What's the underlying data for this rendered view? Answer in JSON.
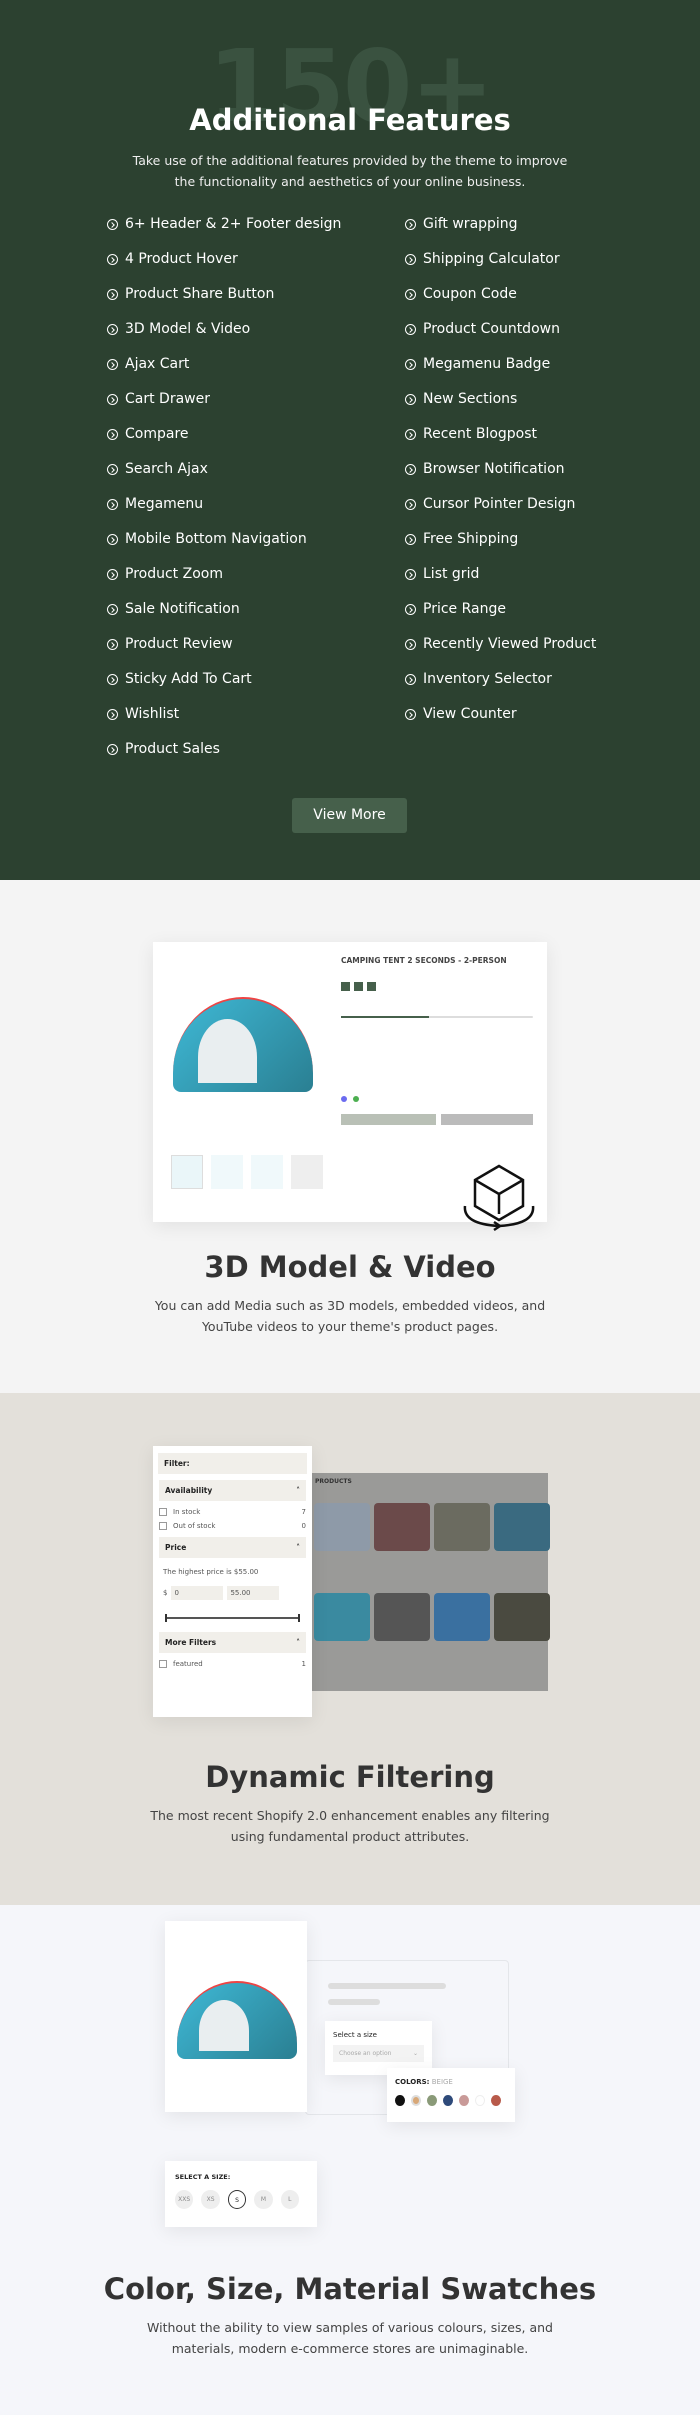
{
  "features": {
    "watermark": "150+",
    "title": "Additional Features",
    "subtitle_lines": [
      "Take use of the additional features provided by the theme to improve",
      "the functionality and aesthetics of your online business."
    ],
    "left": [
      "6+ Header & 2+ Footer design",
      "4 Product Hover",
      "Product Share Button",
      "3D Model & Video",
      "Ajax Cart",
      "Cart Drawer",
      "Compare",
      "Search Ajax",
      "Megamenu",
      "Mobile Bottom Navigation",
      "Product Zoom",
      "Sale Notification",
      "Product Review",
      "Sticky Add To Cart",
      "Wishlist",
      "Product Sales"
    ],
    "right": [
      "Gift wrapping",
      "Shipping Calculator",
      "Coupon Code",
      "Product Countdown",
      "Megamenu Badge",
      "New Sections",
      "Recent Blogpost",
      "Browser Notification",
      "Cursor Pointer Design",
      "Free Shipping",
      "List grid",
      "Price Range",
      "Recently Viewed Product",
      "Inventory Selector",
      "View Counter"
    ],
    "view_more": "View More",
    "icon": "circle-arrow-right-icon",
    "bg_color": "#2c4130"
  },
  "model": {
    "product_title": "CAMPING TENT 2 SECONDS - 2-PERSON",
    "title": "3D Model & Video",
    "subtitle_lines": [
      "You can add Media such as 3D models, embedded videos, and",
      "YouTube videos to your theme's product pages."
    ],
    "icon": "3d-cube-rotate-icon"
  },
  "filter": {
    "heading": "Filter:",
    "availability": "Availability",
    "in_stock": "In stock",
    "in_stock_count": "7",
    "out_of_stock": "Out of stock",
    "out_of_stock_count": "0",
    "price": "Price",
    "highest": "The highest price is $55.00",
    "currency": "$",
    "min": "0",
    "max": "55.00",
    "more": "More Filters",
    "featured": "featured",
    "featured_count": "1",
    "grid_title": "PRODUCTS",
    "title": "Dynamic Filtering",
    "subtitle_lines": [
      "The most recent Shopify 2.0 enhancement enables any filtering",
      "using fundamental product attributes."
    ]
  },
  "swatches": {
    "select_label": "Select a size",
    "select_placeholder": "Choose an option",
    "colors_label": "COLORS:",
    "colors_value": "BEIGE",
    "colors": [
      "#111111",
      "#d8a878",
      "#8a9a78",
      "#2e4a7a",
      "#c99a98",
      "#ffffff",
      "#b85a4a"
    ],
    "size_label": "SELECT A SIZE:",
    "sizes": [
      "XXS",
      "XS",
      "S",
      "M",
      "L"
    ],
    "selected_size": "S",
    "title": "Color, Size, Material Swatches",
    "subtitle_lines": [
      "Without the ability to view samples of various colours, sizes, and",
      "materials, modern e-commerce stores are unimaginable."
    ]
  }
}
